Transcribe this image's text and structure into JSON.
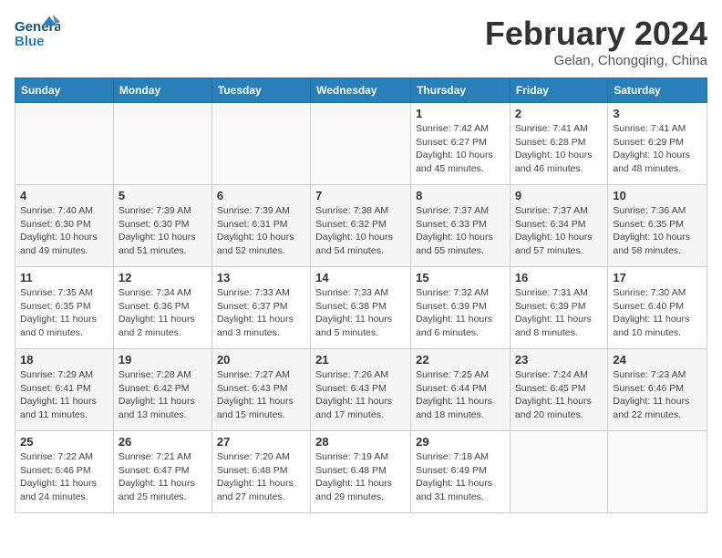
{
  "header": {
    "logo_line1": "General",
    "logo_line2": "Blue",
    "month_year": "February 2024",
    "location": "Gelan, Chongqing, China"
  },
  "weekdays": [
    "Sunday",
    "Monday",
    "Tuesday",
    "Wednesday",
    "Thursday",
    "Friday",
    "Saturday"
  ],
  "weeks": [
    [
      {
        "day": "",
        "info": ""
      },
      {
        "day": "",
        "info": ""
      },
      {
        "day": "",
        "info": ""
      },
      {
        "day": "",
        "info": ""
      },
      {
        "day": "1",
        "info": "Sunrise: 7:42 AM\nSunset: 6:27 PM\nDaylight: 10 hours and 45 minutes."
      },
      {
        "day": "2",
        "info": "Sunrise: 7:41 AM\nSunset: 6:28 PM\nDaylight: 10 hours and 46 minutes."
      },
      {
        "day": "3",
        "info": "Sunrise: 7:41 AM\nSunset: 6:29 PM\nDaylight: 10 hours and 48 minutes."
      }
    ],
    [
      {
        "day": "4",
        "info": "Sunrise: 7:40 AM\nSunset: 6:30 PM\nDaylight: 10 hours and 49 minutes."
      },
      {
        "day": "5",
        "info": "Sunrise: 7:39 AM\nSunset: 6:30 PM\nDaylight: 10 hours and 51 minutes."
      },
      {
        "day": "6",
        "info": "Sunrise: 7:39 AM\nSunset: 6:31 PM\nDaylight: 10 hours and 52 minutes."
      },
      {
        "day": "7",
        "info": "Sunrise: 7:38 AM\nSunset: 6:32 PM\nDaylight: 10 hours and 54 minutes."
      },
      {
        "day": "8",
        "info": "Sunrise: 7:37 AM\nSunset: 6:33 PM\nDaylight: 10 hours and 55 minutes."
      },
      {
        "day": "9",
        "info": "Sunrise: 7:37 AM\nSunset: 6:34 PM\nDaylight: 10 hours and 57 minutes."
      },
      {
        "day": "10",
        "info": "Sunrise: 7:36 AM\nSunset: 6:35 PM\nDaylight: 10 hours and 58 minutes."
      }
    ],
    [
      {
        "day": "11",
        "info": "Sunrise: 7:35 AM\nSunset: 6:35 PM\nDaylight: 11 hours and 0 minutes."
      },
      {
        "day": "12",
        "info": "Sunrise: 7:34 AM\nSunset: 6:36 PM\nDaylight: 11 hours and 2 minutes."
      },
      {
        "day": "13",
        "info": "Sunrise: 7:33 AM\nSunset: 6:37 PM\nDaylight: 11 hours and 3 minutes."
      },
      {
        "day": "14",
        "info": "Sunrise: 7:33 AM\nSunset: 6:38 PM\nDaylight: 11 hours and 5 minutes."
      },
      {
        "day": "15",
        "info": "Sunrise: 7:32 AM\nSunset: 6:39 PM\nDaylight: 11 hours and 6 minutes."
      },
      {
        "day": "16",
        "info": "Sunrise: 7:31 AM\nSunset: 6:39 PM\nDaylight: 11 hours and 8 minutes."
      },
      {
        "day": "17",
        "info": "Sunrise: 7:30 AM\nSunset: 6:40 PM\nDaylight: 11 hours and 10 minutes."
      }
    ],
    [
      {
        "day": "18",
        "info": "Sunrise: 7:29 AM\nSunset: 6:41 PM\nDaylight: 11 hours and 11 minutes."
      },
      {
        "day": "19",
        "info": "Sunrise: 7:28 AM\nSunset: 6:42 PM\nDaylight: 11 hours and 13 minutes."
      },
      {
        "day": "20",
        "info": "Sunrise: 7:27 AM\nSunset: 6:43 PM\nDaylight: 11 hours and 15 minutes."
      },
      {
        "day": "21",
        "info": "Sunrise: 7:26 AM\nSunset: 6:43 PM\nDaylight: 11 hours and 17 minutes."
      },
      {
        "day": "22",
        "info": "Sunrise: 7:25 AM\nSunset: 6:44 PM\nDaylight: 11 hours and 18 minutes."
      },
      {
        "day": "23",
        "info": "Sunrise: 7:24 AM\nSunset: 6:45 PM\nDaylight: 11 hours and 20 minutes."
      },
      {
        "day": "24",
        "info": "Sunrise: 7:23 AM\nSunset: 6:46 PM\nDaylight: 11 hours and 22 minutes."
      }
    ],
    [
      {
        "day": "25",
        "info": "Sunrise: 7:22 AM\nSunset: 6:46 PM\nDaylight: 11 hours and 24 minutes."
      },
      {
        "day": "26",
        "info": "Sunrise: 7:21 AM\nSunset: 6:47 PM\nDaylight: 11 hours and 25 minutes."
      },
      {
        "day": "27",
        "info": "Sunrise: 7:20 AM\nSunset: 6:48 PM\nDaylight: 11 hours and 27 minutes."
      },
      {
        "day": "28",
        "info": "Sunrise: 7:19 AM\nSunset: 6:48 PM\nDaylight: 11 hours and 29 minutes."
      },
      {
        "day": "29",
        "info": "Sunrise: 7:18 AM\nSunset: 6:49 PM\nDaylight: 11 hours and 31 minutes."
      },
      {
        "day": "",
        "info": ""
      },
      {
        "day": "",
        "info": ""
      }
    ]
  ]
}
